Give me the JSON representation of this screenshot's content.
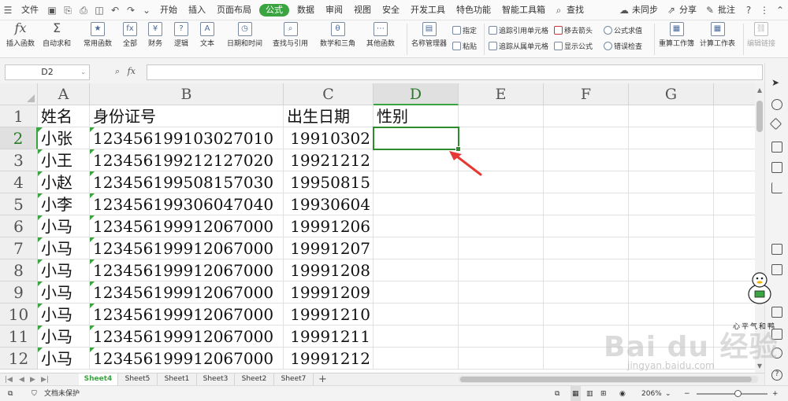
{
  "menubar": {
    "file": "文件",
    "tabs": [
      "开始",
      "插入",
      "页面布局",
      "公式",
      "数据",
      "审阅",
      "视图",
      "安全",
      "开发工具",
      "特色功能",
      "智能工具箱"
    ],
    "active_tab": "公式",
    "search": "查找",
    "sync": "未同步",
    "share": "分享",
    "annotate": "批注"
  },
  "ribbon": {
    "insert_func": "插入函数",
    "autosum": "自动求和",
    "common_func": "常用函数",
    "all": "全部",
    "finance": "财务",
    "logic": "逻辑",
    "text": "文本",
    "datetime": "日期和时间",
    "lookup": "查找与引用",
    "math": "数学和三角",
    "other_func": "其他函数",
    "name_mgr": "名称管理器",
    "specify": "指定",
    "paste": "粘贴",
    "trace_prec": "追踪引用单元格",
    "trace_dep": "追踪从属单元格",
    "remove_arrows": "移去箭头",
    "show_formula": "显示公式",
    "eval_formula": "公式求值",
    "error_check": "错误检查",
    "recalc_book": "重算工作簿",
    "calc_sheet": "计算工作表",
    "edit_links": "编辑链接"
  },
  "formula_bar": {
    "name_box": "D2",
    "fx": "fx",
    "value": ""
  },
  "columns": [
    "A",
    "B",
    "C",
    "D",
    "E",
    "F",
    "G"
  ],
  "selected_column": "D",
  "rows": [
    {
      "num": "1",
      "a": "姓名",
      "b": "身份证号",
      "c": "出生日期",
      "d": "性别"
    },
    {
      "num": "2",
      "a": "小张",
      "b": "123456199103027010",
      "c": "19910302",
      "d": ""
    },
    {
      "num": "3",
      "a": "小王",
      "b": "123456199212127020",
      "c": "19921212",
      "d": ""
    },
    {
      "num": "4",
      "a": "小赵",
      "b": "123456199508157030",
      "c": "19950815",
      "d": ""
    },
    {
      "num": "5",
      "a": "小李",
      "b": "123456199306047040",
      "c": "19930604",
      "d": ""
    },
    {
      "num": "6",
      "a": "小马",
      "b": "123456199912067000",
      "c": "19991206",
      "d": ""
    },
    {
      "num": "7",
      "a": "小马",
      "b": "123456199912067000",
      "c": "19991207",
      "d": ""
    },
    {
      "num": "8",
      "a": "小马",
      "b": "123456199912067000",
      "c": "19991208",
      "d": ""
    },
    {
      "num": "9",
      "a": "小马",
      "b": "123456199912067000",
      "c": "19991209",
      "d": ""
    },
    {
      "num": "10",
      "a": "小马",
      "b": "123456199912067000",
      "c": "19991210",
      "d": ""
    },
    {
      "num": "11",
      "a": "小马",
      "b": "123456199912067000",
      "c": "19991211",
      "d": ""
    },
    {
      "num": "12",
      "a": "小马",
      "b": "123456199912067000",
      "c": "19991212",
      "d": ""
    }
  ],
  "selected_row": "2",
  "sheet_tabs": [
    "Sheet4",
    "Sheet5",
    "Sheet1",
    "Sheet3",
    "Sheet2",
    "Sheet7"
  ],
  "active_sheet": "Sheet4",
  "add_sheet": "+",
  "status": {
    "doc_protect": "文档未保护",
    "zoom": "206%"
  },
  "watermark": {
    "brand": "Bai du 经验",
    "url": "jingyan.baidu.com",
    "caption": "心平气和鸭"
  },
  "colors": {
    "accent": "#3aa540",
    "arrow": "#e53935",
    "selection": "#2e8b2e"
  }
}
